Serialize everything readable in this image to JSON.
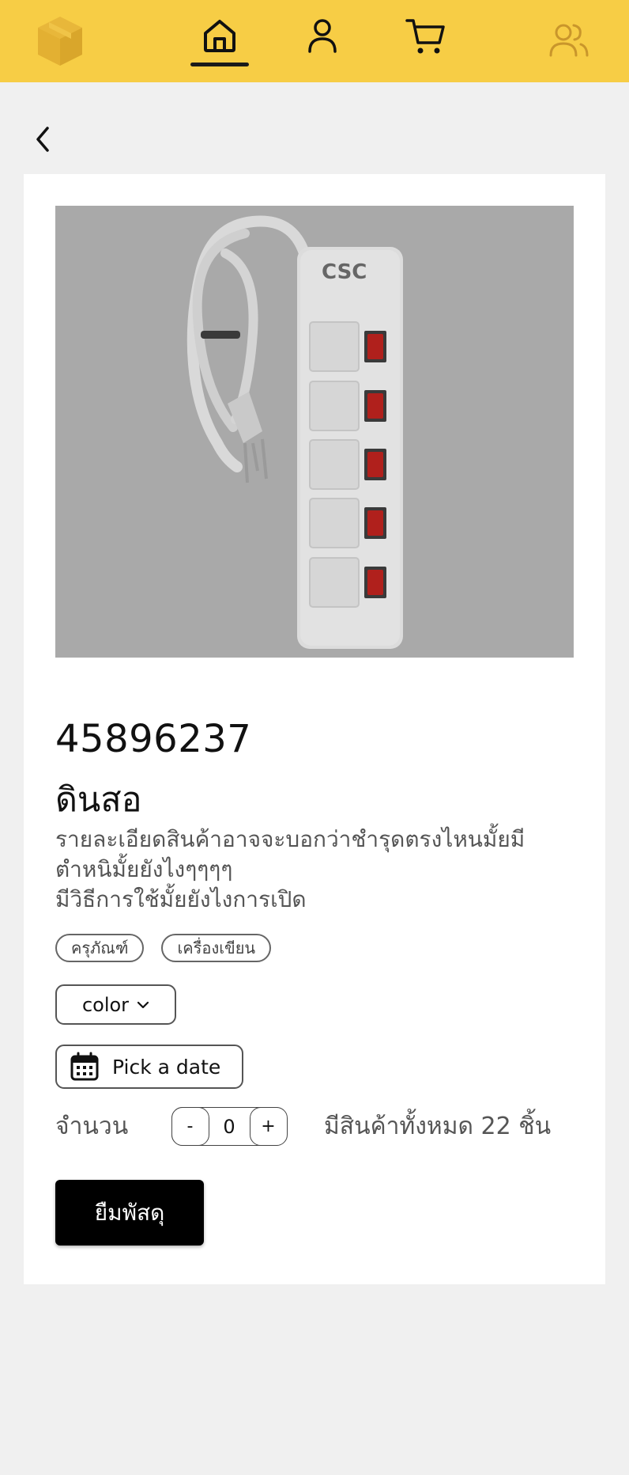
{
  "nav": {
    "logo_icon": "box-icon",
    "items": [
      {
        "icon": "home-icon",
        "active": true
      },
      {
        "icon": "user-icon",
        "active": false
      },
      {
        "icon": "cart-icon",
        "active": false
      },
      {
        "icon": "users-icon",
        "active": false
      }
    ]
  },
  "back_icon": "chevron-left-icon",
  "product": {
    "image_text": "CSC",
    "code": "45896237",
    "name": "ดินสอ",
    "description": "รายละเอียดสินค้าอาจจะบอกว่าชำรุดตรงไหนมั้ยมีตำหนิมั้ยยังไงๆๆๆๆ\nมีวิธีการใช้มั้ยยังไงการเปิด",
    "tags": [
      "ครุภัณฑ์",
      "เครื่องเขียน"
    ],
    "color_select": "color",
    "date_placeholder": "Pick a date",
    "quantity_label": "จำนวน",
    "quantity": {
      "minus": "-",
      "value": "0",
      "plus": "+"
    },
    "stock_text": "มีสินค้าทั้งหมด 22 ชิ้น",
    "borrow_button": "ยืมพัสดุ"
  },
  "colors": {
    "topbar": "#f7cd45",
    "background": "#f0f0f0",
    "card": "#ffffff",
    "image_bg": "#a9a9a9",
    "primary_button": "#000000"
  }
}
